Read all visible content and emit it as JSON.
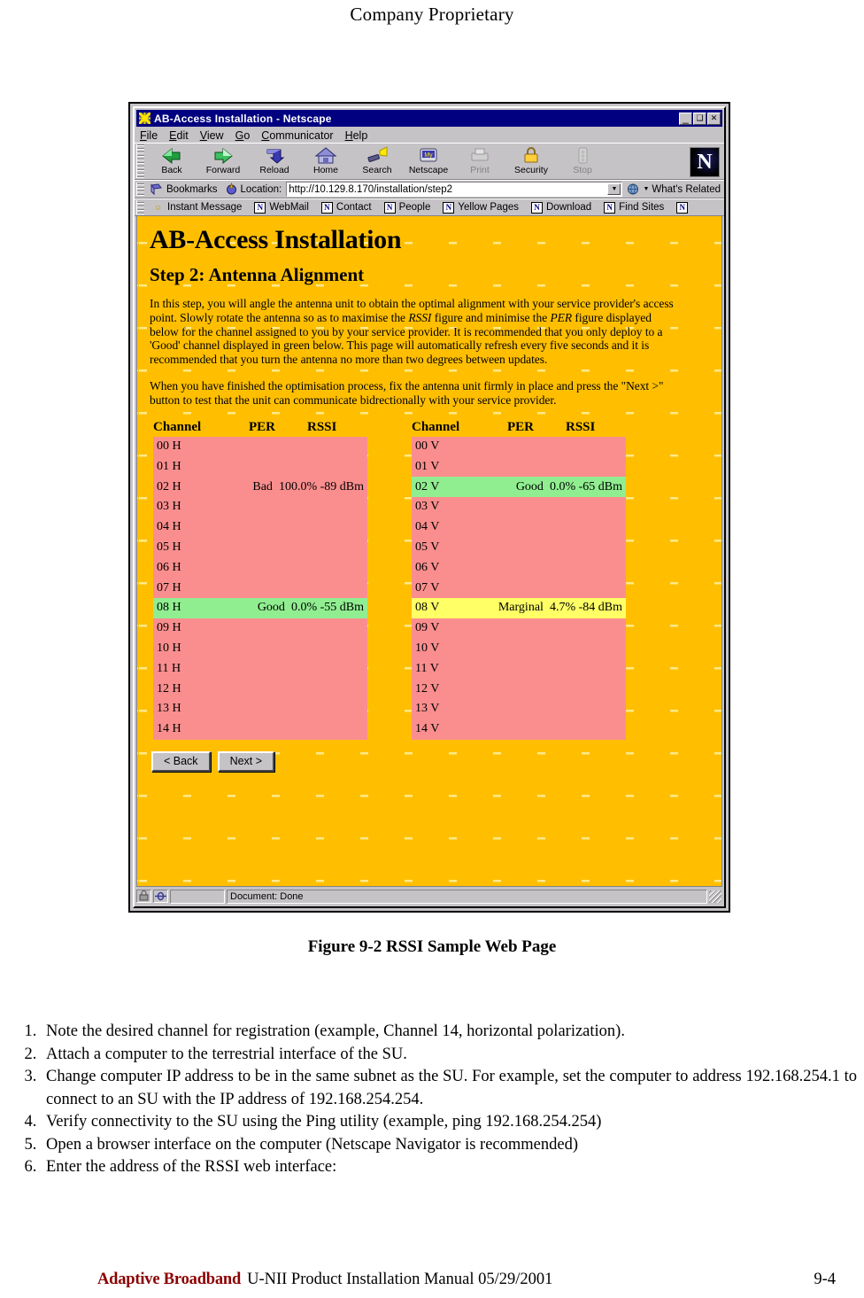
{
  "document": {
    "header": "Company Proprietary",
    "figure_caption": "Figure 9-2  RSSI Sample Web Page",
    "steps": [
      "Note the desired channel for registration (example, Channel 14, horizontal polarization).",
      "Attach a computer to the terrestrial interface of the SU.",
      "Change computer IP address to be in the same subnet as the SU.  For example, set the computer to address 192.168.254.1 to connect to an SU with the IP address of 192.168.254.254.",
      "Verify connectivity to the SU using the Ping utility (example, ping 192.168.254.254)",
      "Open a browser interface on the computer (Netscape Navigator is recommended)",
      "Enter the address of the RSSI web interface:"
    ],
    "footer": {
      "brand": "Adaptive Broadband",
      "manual_title": "U-NII Product Installation Manual  05/29/2001",
      "page_number": "9-4"
    }
  },
  "browser": {
    "title": "AB-Access Installation - Netscape",
    "window_buttons": {
      "minimize": "_",
      "maximize": "❑",
      "close": "✕"
    },
    "menus": [
      {
        "label": "File",
        "accel": "F"
      },
      {
        "label": "Edit",
        "accel": "E"
      },
      {
        "label": "View",
        "accel": "V"
      },
      {
        "label": "Go",
        "accel": "G"
      },
      {
        "label": "Communicator",
        "accel": "C"
      },
      {
        "label": "Help",
        "accel": "H"
      }
    ],
    "toolbar": [
      {
        "label": "Back",
        "icon": "back-arrow-icon",
        "disabled": false
      },
      {
        "label": "Forward",
        "icon": "forward-arrow-icon",
        "disabled": false
      },
      {
        "label": "Reload",
        "icon": "reload-icon",
        "disabled": false
      },
      {
        "label": "Home",
        "icon": "home-icon",
        "disabled": false
      },
      {
        "label": "Search",
        "icon": "search-flashlight-icon",
        "disabled": false
      },
      {
        "label": "Netscape",
        "icon": "netscape-my-icon",
        "disabled": false
      },
      {
        "label": "Print",
        "icon": "printer-icon",
        "disabled": true
      },
      {
        "label": "Security",
        "icon": "lock-icon",
        "disabled": false
      },
      {
        "label": "Stop",
        "icon": "stop-light-icon",
        "disabled": true
      }
    ],
    "logo_letter": "N",
    "location": {
      "bookmarks_label": "Bookmarks",
      "location_label": "Location:",
      "url": "http://10.129.8.170/installation/step2",
      "whats_related_label": "What's Related",
      "dropdown_glyph": "▼"
    },
    "personal_toolbar": [
      {
        "label": "Instant Message",
        "icon": "running-man-icon"
      },
      {
        "label": "WebMail",
        "icon": "netscape-page-icon"
      },
      {
        "label": "Contact",
        "icon": "netscape-page-icon"
      },
      {
        "label": "People",
        "icon": "netscape-page-icon"
      },
      {
        "label": "Yellow Pages",
        "icon": "netscape-page-icon"
      },
      {
        "label": "Download",
        "icon": "netscape-page-icon"
      },
      {
        "label": "Find Sites",
        "icon": "netscape-page-icon"
      }
    ],
    "statusbar": {
      "text": "Document: Done"
    }
  },
  "webpage": {
    "title": "AB-Access Installation",
    "subtitle": "Step 2: Antenna Alignment",
    "paragraph1_a": "In this step, you will angle the antenna unit to obtain the optimal alignment with your service provider's access point. Slowly rotate the antenna so as to maximise the ",
    "paragraph1_em1": "RSSI",
    "paragraph1_b": " figure and minimise the ",
    "paragraph1_em2": "PER",
    "paragraph1_c": " figure displayed below for the channel assigned to you by your service provider. It is recommended that you only deploy to a 'Good' channel displayed in green below. This page will automatically refresh every five seconds and it is recommended that you turn the antenna no more than two degrees between updates.",
    "paragraph2": "When you have finished the optimisation process, fix the antenna unit firmly in place and press the \"Next >\" button to test that the unit can communicate bidrectionally with your service provider.",
    "columns": {
      "channel": "Channel",
      "per": "PER",
      "rssi": "RSSI"
    },
    "buttons": {
      "back": "< Back",
      "next": "Next >"
    },
    "colors": {
      "page_background": "#ffbf00",
      "plus_pattern": "#ffe98a",
      "row_bad": "#fa8e8e",
      "row_good": "#90ee90",
      "row_marginal": "#ffff66"
    },
    "table_horizontal": [
      {
        "channel": "00 H",
        "state": "",
        "per": "",
        "rssi": "",
        "status": "bad"
      },
      {
        "channel": "01 H",
        "state": "",
        "per": "",
        "rssi": "",
        "status": "bad"
      },
      {
        "channel": "02 H",
        "state": "Bad",
        "per": "100.0%",
        "rssi": "-89 dBm",
        "status": "bad"
      },
      {
        "channel": "03 H",
        "state": "",
        "per": "",
        "rssi": "",
        "status": "bad"
      },
      {
        "channel": "04 H",
        "state": "",
        "per": "",
        "rssi": "",
        "status": "bad"
      },
      {
        "channel": "05 H",
        "state": "",
        "per": "",
        "rssi": "",
        "status": "bad"
      },
      {
        "channel": "06 H",
        "state": "",
        "per": "",
        "rssi": "",
        "status": "bad"
      },
      {
        "channel": "07 H",
        "state": "",
        "per": "",
        "rssi": "",
        "status": "bad"
      },
      {
        "channel": "08 H",
        "state": "Good",
        "per": "0.0%",
        "rssi": "-55 dBm",
        "status": "good"
      },
      {
        "channel": "09 H",
        "state": "",
        "per": "",
        "rssi": "",
        "status": "bad"
      },
      {
        "channel": "10 H",
        "state": "",
        "per": "",
        "rssi": "",
        "status": "bad"
      },
      {
        "channel": "11 H",
        "state": "",
        "per": "",
        "rssi": "",
        "status": "bad"
      },
      {
        "channel": "12 H",
        "state": "",
        "per": "",
        "rssi": "",
        "status": "bad"
      },
      {
        "channel": "13 H",
        "state": "",
        "per": "",
        "rssi": "",
        "status": "bad"
      },
      {
        "channel": "14 H",
        "state": "",
        "per": "",
        "rssi": "",
        "status": "bad"
      }
    ],
    "table_vertical": [
      {
        "channel": "00 V",
        "state": "",
        "per": "",
        "rssi": "",
        "status": "bad"
      },
      {
        "channel": "01 V",
        "state": "",
        "per": "",
        "rssi": "",
        "status": "bad"
      },
      {
        "channel": "02 V",
        "state": "Good",
        "per": "0.0%",
        "rssi": "-65 dBm",
        "status": "good"
      },
      {
        "channel": "03 V",
        "state": "",
        "per": "",
        "rssi": "",
        "status": "bad"
      },
      {
        "channel": "04 V",
        "state": "",
        "per": "",
        "rssi": "",
        "status": "bad"
      },
      {
        "channel": "05 V",
        "state": "",
        "per": "",
        "rssi": "",
        "status": "bad"
      },
      {
        "channel": "06 V",
        "state": "",
        "per": "",
        "rssi": "",
        "status": "bad"
      },
      {
        "channel": "07 V",
        "state": "",
        "per": "",
        "rssi": "",
        "status": "bad"
      },
      {
        "channel": "08 V",
        "state": "Marginal",
        "per": "4.7%",
        "rssi": "-84 dBm",
        "status": "marginal"
      },
      {
        "channel": "09 V",
        "state": "",
        "per": "",
        "rssi": "",
        "status": "bad"
      },
      {
        "channel": "10 V",
        "state": "",
        "per": "",
        "rssi": "",
        "status": "bad"
      },
      {
        "channel": "11 V",
        "state": "",
        "per": "",
        "rssi": "",
        "status": "bad"
      },
      {
        "channel": "12 V",
        "state": "",
        "per": "",
        "rssi": "",
        "status": "bad"
      },
      {
        "channel": "13 V",
        "state": "",
        "per": "",
        "rssi": "",
        "status": "bad"
      },
      {
        "channel": "14 V",
        "state": "",
        "per": "",
        "rssi": "",
        "status": "bad"
      }
    ]
  }
}
